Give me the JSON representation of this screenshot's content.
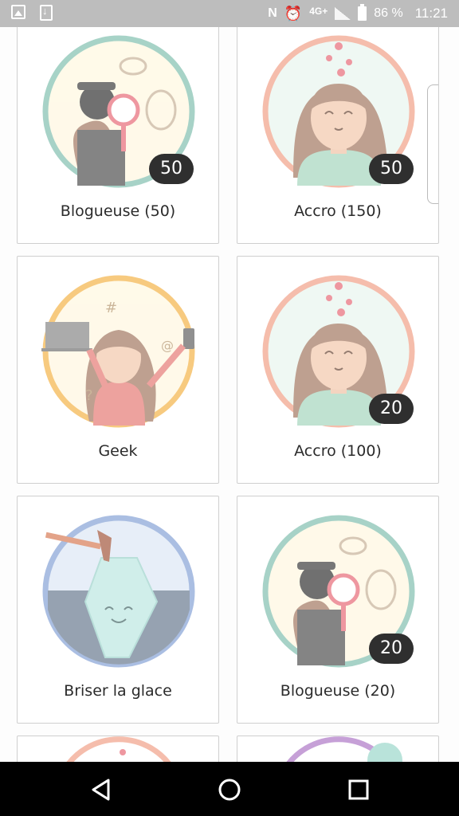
{
  "status_bar": {
    "network": "4G+",
    "battery": "86 %",
    "time": "11:21"
  },
  "badges": [
    {
      "label": "Blogueuse (50)",
      "count": "50",
      "art": "detective-icon"
    },
    {
      "label": "Accro (150)",
      "count": "50",
      "art": "lovestruck-girl-icon"
    },
    {
      "label": "Geek",
      "count": "",
      "art": "geek-girl-icon"
    },
    {
      "label": "Accro (100)",
      "count": "20",
      "art": "lovestruck-girl-icon"
    },
    {
      "label": "Briser la glace",
      "count": "",
      "art": "iceberg-icon"
    },
    {
      "label": "Blogueuse (20)",
      "count": "20",
      "art": "detective-icon"
    }
  ],
  "colors": {
    "status_bar": "#bdbdbd",
    "card_border": "#cfcfcf",
    "badge_bg": "#2f2f2f",
    "detective_ring": "#9fd0c4",
    "accro_ring": "#f5b8a4",
    "geek_ring": "#f7c46a",
    "ice_ring": "#9db7e0"
  }
}
